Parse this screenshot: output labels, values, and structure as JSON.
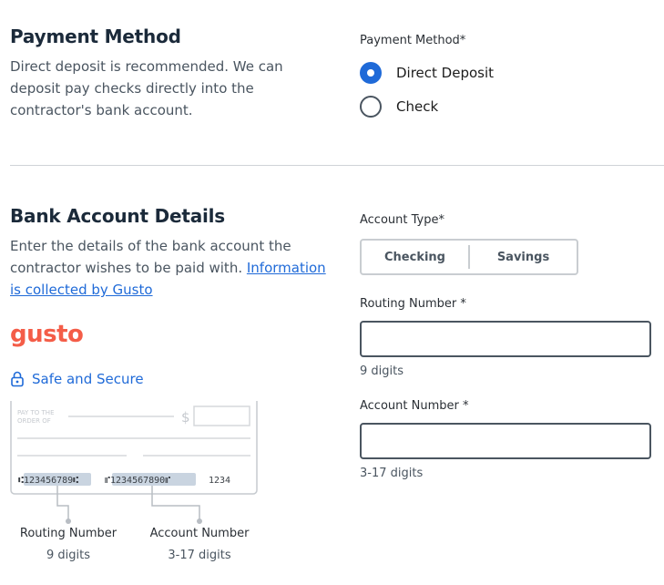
{
  "payment": {
    "title": "Payment Method",
    "description": "Direct deposit is recommended. We can deposit pay checks directly into the contractor's bank account.",
    "field_label": "Payment Method*",
    "options": [
      {
        "label": "Direct Deposit",
        "checked": true
      },
      {
        "label": "Check",
        "checked": false
      }
    ]
  },
  "bank": {
    "title": "Bank Account Details",
    "description_text": "Enter the details of the bank account the contractor wishes to be paid with. ",
    "description_link": "Information is collected by Gusto",
    "account_type_label": "Account Type*",
    "account_types": [
      "Checking",
      "Savings"
    ],
    "routing_label": "Routing Number *",
    "routing_value": "",
    "routing_hint": "9 digits",
    "account_label": "Account Number *",
    "account_value": "",
    "account_hint": "3-17 digits"
  },
  "brand": {
    "logo_text": "gusto",
    "logo_color": "#f45d48",
    "secure_text": "Safe and Secure",
    "secure_icon": "lock-icon"
  },
  "check_illustration": {
    "pay_to_line1": "PAY TO THE",
    "pay_to_line2": "ORDER OF",
    "currency": "$",
    "routing_digits": "⑆123456789⑆",
    "account_digits": "⑈1234567890⑈",
    "check_number": "1234",
    "routing_caption": "Routing Number",
    "routing_caption_sub": "9 digits",
    "account_caption": "Account Number",
    "account_caption_sub": "3-17 digits"
  },
  "colors": {
    "accent": "#1f6ad8",
    "heading": "#1b2a3a",
    "brand": "#f45d48"
  }
}
